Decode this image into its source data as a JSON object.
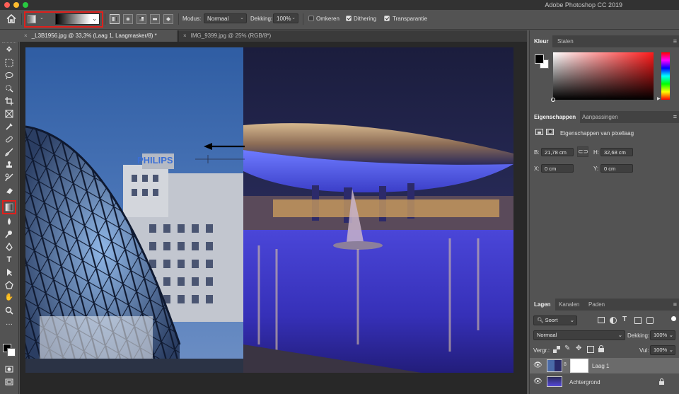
{
  "window": {
    "app_title": "Adobe Photoshop CC 2019",
    "traffic_colors": [
      "#ff5f57",
      "#febc2e",
      "#28c840"
    ]
  },
  "options_bar": {
    "mode_label": "Modus:",
    "mode_value": "Normaal",
    "opacity_label": "Dekking:",
    "opacity_value": "100%",
    "reverse_label": "Omkeren",
    "reverse_checked": false,
    "dither_label": "Dithering",
    "dither_checked": true,
    "transparency_label": "Transparantie",
    "transparency_checked": true,
    "highlight_color": "#e0201c"
  },
  "tabs": [
    {
      "label": "_L3B1956.jpg @ 33,3% (Laag 1, Laagmasker/8) *",
      "active": true
    },
    {
      "label": "IMG_9399.jpg @ 25% (RGB/8*)",
      "active": false
    }
  ],
  "toolbar": {
    "tools": [
      "move",
      "marquee",
      "lasso",
      "quick-select",
      "crop",
      "frame",
      "eyedropper",
      "healing",
      "brush",
      "stamp",
      "history-brush",
      "eraser",
      "gradient",
      "blur",
      "dodge",
      "pen",
      "type",
      "path-select",
      "shape",
      "hand",
      "zoom",
      "more"
    ],
    "active_tool": "gradient"
  },
  "color_panel": {
    "tab_active": "Kleur",
    "tab_other": "Stalen"
  },
  "properties_panel": {
    "tab_active": "Eigenschappen",
    "tab_other": "Aanpassingen",
    "subtitle": "Eigenschappen van pixellaag",
    "w_label": "B:",
    "w_value": "21,78 cm",
    "h_label": "H:",
    "h_value": "32,68 cm",
    "x_label": "X:",
    "x_value": "0 cm",
    "y_label": "Y:",
    "y_value": "0 cm"
  },
  "layers_panel": {
    "tab_active": "Lagen",
    "tab_channels": "Kanalen",
    "tab_paths": "Paden",
    "filter_label": "Soort",
    "blend_mode": "Normaal",
    "opacity_label": "Dekking:",
    "opacity_value": "100%",
    "lock_label": "Vergr.:",
    "fill_label": "Vul:",
    "fill_value": "100%",
    "layers": [
      {
        "name": "Laag 1",
        "selected": true
      },
      {
        "name": "Achtergrond",
        "selected": false
      }
    ]
  }
}
